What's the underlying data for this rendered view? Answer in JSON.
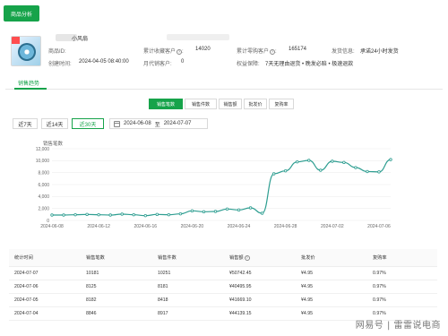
{
  "top_button": {
    "label": "商品分析"
  },
  "product": {
    "title_fragment": "小风扇",
    "id_label": "商品ID:",
    "created_label": "创建时间:",
    "created_value": "2024-04-05 08:40:00",
    "fav_label": "累计收藏客户",
    "fav_value": "14020",
    "sales_label": "月代销客户:",
    "sales_value": "0",
    "cum_buyers_label": "累计零购客户",
    "cum_buyers_value": "165174",
    "ship_label": "发货信息:",
    "ship_value": "承诺24小时发货",
    "rights_label": "权益保障:",
    "rights_value": "7天无理由退货 • 晚发必赔 • 极速退款"
  },
  "tabs": {
    "active": "销售趋势"
  },
  "segments": [
    {
      "label": "销售笔数",
      "active": true
    },
    {
      "label": "销售件数",
      "active": false
    },
    {
      "label": "销售额",
      "active": false
    },
    {
      "label": "批发价",
      "active": false
    },
    {
      "label": "复购率",
      "active": false
    }
  ],
  "ranges": [
    {
      "label": "近7天",
      "active": false
    },
    {
      "label": "近14天",
      "active": false
    },
    {
      "label": "近30天",
      "active": true
    }
  ],
  "date_range": {
    "start": "2024-06-08",
    "sep": "至",
    "end": "2024-07-07"
  },
  "chart_data": {
    "type": "line",
    "ylabel": "销售笔数",
    "ylim": [
      0,
      12000
    ],
    "y_ticks": [
      "0",
      "2,000",
      "4,000",
      "6,000",
      "8,000",
      "10,000",
      "12,000"
    ],
    "x_ticks": [
      "2024-06-08",
      "2024-06-12",
      "2024-06-16",
      "2024-06-20",
      "2024-06-24",
      "2024-06-28",
      "2024-07-02",
      "2024-07-06"
    ],
    "x": [
      "2024-06-08",
      "2024-06-09",
      "2024-06-10",
      "2024-06-11",
      "2024-06-12",
      "2024-06-13",
      "2024-06-14",
      "2024-06-15",
      "2024-06-16",
      "2024-06-17",
      "2024-06-18",
      "2024-06-19",
      "2024-06-20",
      "2024-06-21",
      "2024-06-22",
      "2024-06-23",
      "2024-06-24",
      "2024-06-25",
      "2024-06-26",
      "2024-06-27",
      "2024-06-28",
      "2024-06-29",
      "2024-06-30",
      "2024-07-01",
      "2024-07-02",
      "2024-07-03",
      "2024-07-04",
      "2024-07-05",
      "2024-07-06",
      "2024-07-07"
    ],
    "series": [
      {
        "values": [
          900,
          900,
          950,
          1000,
          950,
          900,
          1050,
          950,
          800,
          1000,
          950,
          1100,
          1600,
          1450,
          1500,
          1900,
          1750,
          2100,
          1200,
          7800,
          8300,
          9800,
          10050,
          8400,
          9900,
          9700,
          8846,
          8182,
          8125,
          10181
        ]
      }
    ],
    "color": "#2e9e91",
    "grid": true
  },
  "table": {
    "headers": [
      "统计时间",
      "销售笔数",
      "销售件数",
      "销售额",
      "批发价",
      "复购率"
    ],
    "rows": [
      [
        "2024-07-07",
        "10181",
        "10251",
        "¥50742.45",
        "¥4.95",
        "0.97%"
      ],
      [
        "2024-07-06",
        "8125",
        "8181",
        "¥40495.95",
        "¥4.95",
        "0.97%"
      ],
      [
        "2024-07-05",
        "8182",
        "8418",
        "¥41669.10",
        "¥4.95",
        "0.97%"
      ],
      [
        "2024-07-04",
        "8846",
        "8917",
        "¥44139.15",
        "¥4.95",
        "0.97%"
      ]
    ]
  },
  "watermark": "网易号 | 雷雷说电商"
}
